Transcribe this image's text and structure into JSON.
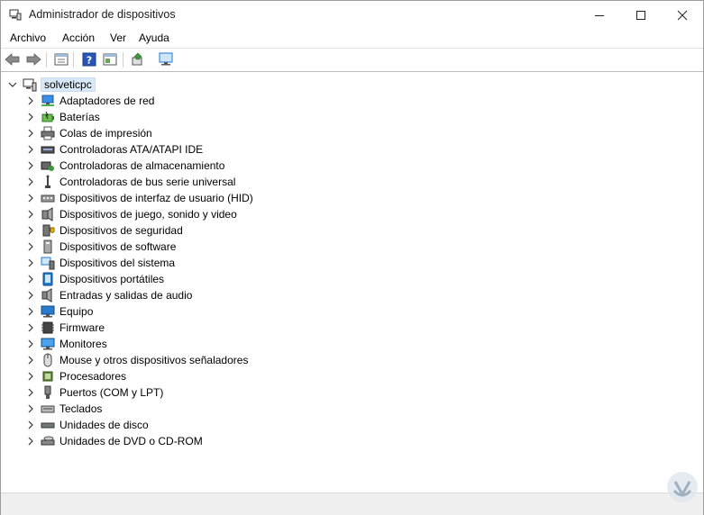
{
  "window": {
    "title": "Administrador de dispositivos",
    "controls": [
      "minimize-icon",
      "maximize-icon",
      "close-icon"
    ]
  },
  "menu": [
    "Archivo",
    "Acción",
    "Ver",
    "Ayuda"
  ],
  "toolbar": {
    "buttons": [
      "back-arrow-icon",
      "forward-arrow-icon",
      "properties-icon",
      "help-icon",
      "details-pane-icon",
      "update-driver-icon",
      "scan-hardware-icon"
    ]
  },
  "tree": {
    "root": "solveticpc",
    "categories": [
      {
        "label": "Adaptadores de red",
        "icon": "network-adapter-icon"
      },
      {
        "label": "Baterías",
        "icon": "battery-icon"
      },
      {
        "label": "Colas de impresión",
        "icon": "printer-icon"
      },
      {
        "label": "Controladoras ATA/ATAPI IDE",
        "icon": "ide-controller-icon"
      },
      {
        "label": "Controladoras de almacenamiento",
        "icon": "storage-controller-icon"
      },
      {
        "label": "Controladoras de bus serie universal",
        "icon": "usb-icon"
      },
      {
        "label": "Dispositivos de interfaz de usuario (HID)",
        "icon": "hid-icon"
      },
      {
        "label": "Dispositivos de juego, sonido y video",
        "icon": "speaker-icon"
      },
      {
        "label": "Dispositivos de seguridad",
        "icon": "security-device-icon"
      },
      {
        "label": "Dispositivos de software",
        "icon": "software-device-icon"
      },
      {
        "label": "Dispositivos del sistema",
        "icon": "system-device-icon"
      },
      {
        "label": "Dispositivos portátiles",
        "icon": "portable-device-icon"
      },
      {
        "label": "Entradas y salidas de audio",
        "icon": "audio-io-icon"
      },
      {
        "label": "Equipo",
        "icon": "computer-icon"
      },
      {
        "label": "Firmware",
        "icon": "firmware-chip-icon"
      },
      {
        "label": "Monitores",
        "icon": "monitor-icon"
      },
      {
        "label": "Mouse y otros dispositivos señaladores",
        "icon": "mouse-icon"
      },
      {
        "label": "Procesadores",
        "icon": "processor-icon"
      },
      {
        "label": "Puertos (COM y LPT)",
        "icon": "port-icon"
      },
      {
        "label": "Teclados",
        "icon": "keyboard-icon"
      },
      {
        "label": "Unidades de disco",
        "icon": "disk-drive-icon"
      },
      {
        "label": "Unidades de DVD o CD-ROM",
        "icon": "dvd-drive-icon"
      }
    ]
  },
  "colors": {
    "selection_bg": "#d8e8f6",
    "accent_blue": "#1f7bd4"
  }
}
